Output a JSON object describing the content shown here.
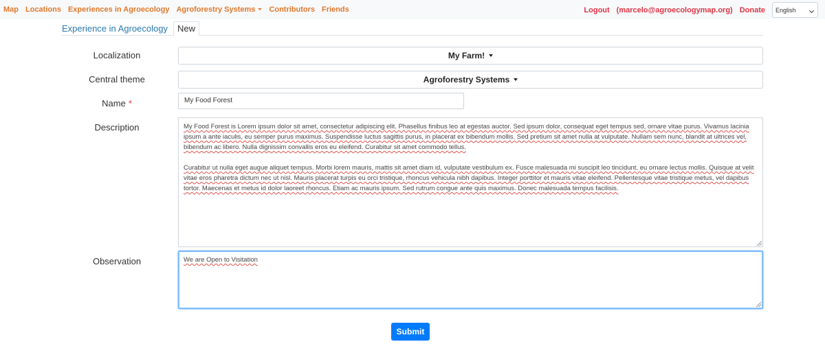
{
  "nav": {
    "items": [
      "Map",
      "Locations",
      "Experiences in Agroecology",
      "Agroforestry Systems",
      "Contributors",
      "Friends"
    ],
    "logout": "Logout",
    "user_email": "(marcelo@agroecologymap.org)",
    "donate": "Donate",
    "language": "English"
  },
  "tabs": {
    "title": "Experience in Agroecology",
    "active": "New"
  },
  "form": {
    "localization": {
      "label": "Localization",
      "value": "My Farm!"
    },
    "central_theme": {
      "label": "Central theme",
      "value": "Agroforestry Systems"
    },
    "name": {
      "label": "Name",
      "required_mark": "*",
      "value": "My Food Forest"
    },
    "description": {
      "label": "Description",
      "paragraphs": [
        "My Food Forest is Lorem ipsum dolor sit amet, consectetur adipiscing elit. Phasellus finibus leo at egestas auctor. Sed ipsum dolor, consequat eget tempus sed, ornare vitae purus. Vivamus lacinia ipsum a ante iaculis, eu semper purus maximus. Suspendisse luctus sagittis purus, in placerat ex bibendum mollis. Sed pretium sit amet nulla at vulputate. Nullam sem nunc, blandit at ultrices vel, bibendum ac libero. Nulla dignissim convallis eros eu eleifend. Curabitur sit amet commodo tellus.",
        "Curabitur ut nulla eget augue aliquet tempus. Morbi lorem mauris, mattis sit amet diam id, vulputate vestibulum ex. Fusce malesuada mi suscipit leo tincidunt, eu ornare lectus mollis. Quisque at velit vitae eros pharetra dictum nec ut nisl. Mauris placerat turpis eu orci tristique, rhoncus vehicula nibh dapibus. Integer porttitor et mauris vitae eleifend. Pellentesque vitae tristique metus, vel dapibus tortor. Maecenas et metus id dolor laoreet rhoncus. Etiam ac mauris ipsum. Sed rutrum congue ante quis maximus. Donec malesuada tempus facilisis."
      ]
    },
    "observation": {
      "label": "Observation",
      "value": "We are Open to Visitation"
    },
    "submit": "Submit"
  },
  "colors": {
    "nav_link": "#e0782a",
    "nav_user": "#dc3545",
    "tab_title": "#2a7ab0",
    "submit_bg": "#007bff"
  }
}
